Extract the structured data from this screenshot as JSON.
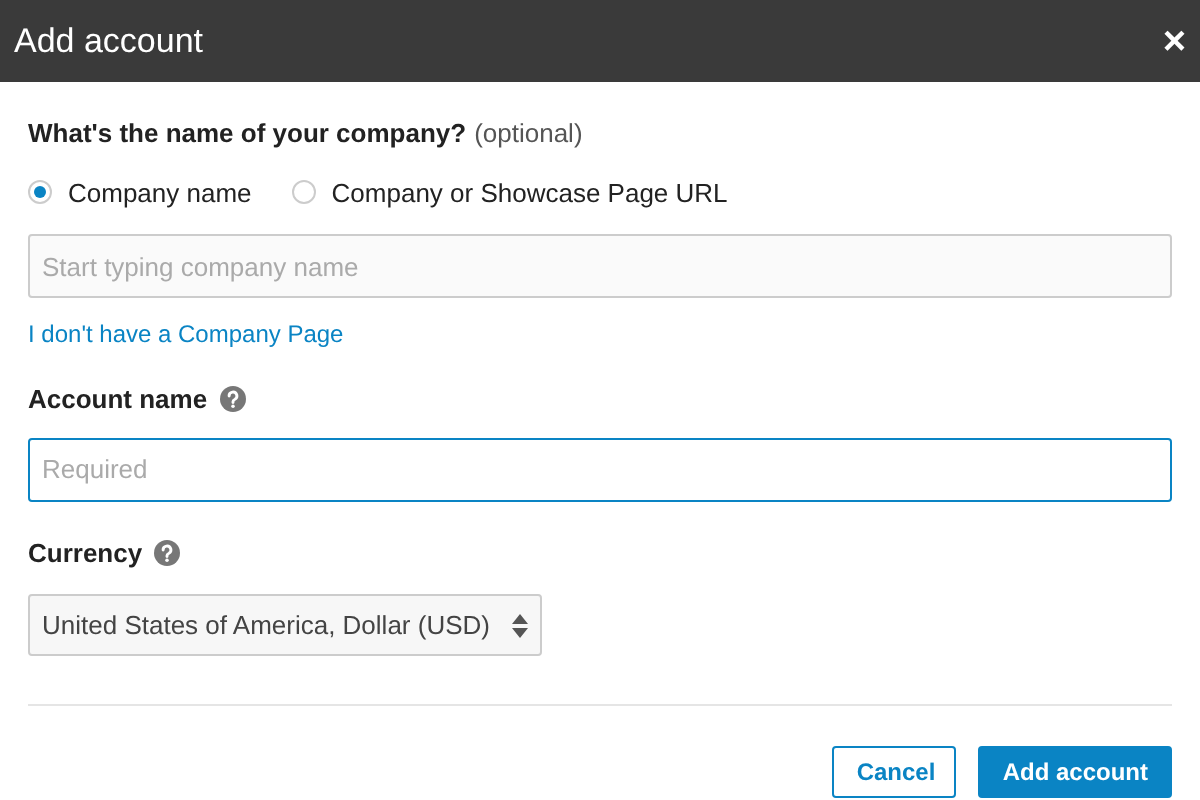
{
  "window": {
    "title": "Add account",
    "close": "×"
  },
  "company": {
    "label": "What's the name of your company?",
    "hint": "(optional)",
    "options": [
      {
        "label": "Company name",
        "selected": true
      },
      {
        "label": "Company or Showcase Page URL",
        "selected": false
      }
    ],
    "field": {
      "placeholder": "Start typing company name",
      "focused": false
    },
    "link": "I don't have a Company Page"
  },
  "account_name": {
    "label": "Account name",
    "field": {
      "placeholder": "Required",
      "focused": true
    }
  },
  "currency": {
    "label": "Currency",
    "value": "United States of America, Dollar (USD)"
  },
  "buttons": [
    {
      "label": "Cancel",
      "kind": "secondary"
    },
    {
      "label": "Add account",
      "kind": "primary"
    }
  ]
}
